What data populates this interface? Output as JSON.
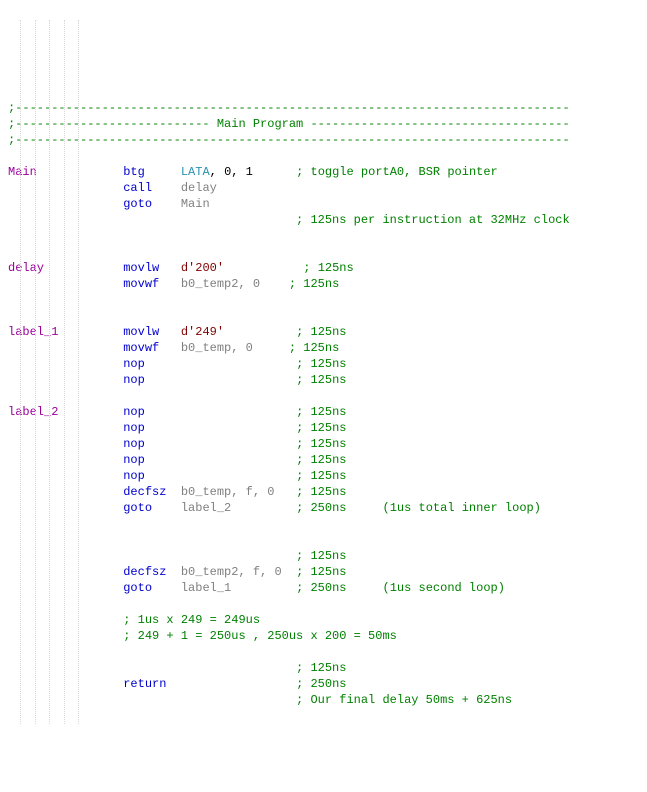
{
  "sep1": ";-----------------------------------------------------------------------------",
  "sep2": ";--------------------------- Main Program ------------------------------------",
  "sep3": ";-----------------------------------------------------------------------------",
  "main_label": "Main",
  "btg": "btg",
  "lata": "LATA",
  "lata_args": ", 0, 1",
  "main_cmt": "; toggle portA0, BSR pointer",
  "call": "call",
  "delay_ref": "delay",
  "goto": "goto",
  "main_ref": "Main",
  "clk_cmt": "; 125ns per instruction at 32MHz clock",
  "delay_label": "delay",
  "movlw": "movlw",
  "d200": "d'200'",
  "c125": "; 125ns",
  "movwf": "movwf",
  "b0_temp2_0": "b0_temp2, 0",
  "label1": "label_1",
  "d249": "d'249'",
  "b0_temp_0": "b0_temp, 0",
  "nop": "nop",
  "label2": "label_2",
  "decfsz": "decfsz",
  "b0_temp_f0": "b0_temp, f, 0",
  "label2_ref": "label_2",
  "c250": "; 250ns",
  "inner_loop": "(1us total inner loop)",
  "b0_temp2_f0": "b0_temp2, f, 0",
  "label1_ref": "label_1",
  "second_loop": "(1us second loop)",
  "calc1": "; 1us x 249 = 249us",
  "calc2": "; 249 + 1 = 250us , 250us x 200 = 50ms",
  "return": "return",
  "final": "; Our final delay 50ms + 625ns",
  "chart_data": {
    "type": "table",
    "title": "PIC assembly delay routine (Main Program)",
    "note": "125ns per instruction at 32MHz clock",
    "rows": [
      {
        "label": "Main",
        "mnemonic": "btg",
        "operands": "LATA, 0, 1",
        "comment": "toggle portA0, BSR pointer"
      },
      {
        "label": "",
        "mnemonic": "call",
        "operands": "delay",
        "comment": ""
      },
      {
        "label": "",
        "mnemonic": "goto",
        "operands": "Main",
        "comment": ""
      },
      {
        "label": "delay",
        "mnemonic": "movlw",
        "operands": "d'200'",
        "comment": "125ns"
      },
      {
        "label": "",
        "mnemonic": "movwf",
        "operands": "b0_temp2, 0",
        "comment": "125ns"
      },
      {
        "label": "label_1",
        "mnemonic": "movlw",
        "operands": "d'249'",
        "comment": "125ns"
      },
      {
        "label": "",
        "mnemonic": "movwf",
        "operands": "b0_temp, 0",
        "comment": "125ns"
      },
      {
        "label": "",
        "mnemonic": "nop",
        "operands": "",
        "comment": "125ns"
      },
      {
        "label": "",
        "mnemonic": "nop",
        "operands": "",
        "comment": "125ns"
      },
      {
        "label": "label_2",
        "mnemonic": "nop",
        "operands": "",
        "comment": "125ns"
      },
      {
        "label": "",
        "mnemonic": "nop",
        "operands": "",
        "comment": "125ns"
      },
      {
        "label": "",
        "mnemonic": "nop",
        "operands": "",
        "comment": "125ns"
      },
      {
        "label": "",
        "mnemonic": "nop",
        "operands": "",
        "comment": "125ns"
      },
      {
        "label": "",
        "mnemonic": "nop",
        "operands": "",
        "comment": "125ns"
      },
      {
        "label": "",
        "mnemonic": "decfsz",
        "operands": "b0_temp, f, 0",
        "comment": "125ns"
      },
      {
        "label": "",
        "mnemonic": "goto",
        "operands": "label_2",
        "comment": "250ns (1us total inner loop)"
      },
      {
        "label": "",
        "mnemonic": "decfsz",
        "operands": "b0_temp2, f, 0",
        "comment": "125ns"
      },
      {
        "label": "",
        "mnemonic": "goto",
        "operands": "label_1",
        "comment": "250ns (1us second loop)"
      },
      {
        "label": "",
        "mnemonic": "return",
        "operands": "",
        "comment": "250ns"
      }
    ],
    "derived": [
      "1us x 249 = 249us",
      "249 + 1 = 250us , 250us x 200 = 50ms",
      "Our final delay 50ms + 625ns"
    ]
  }
}
